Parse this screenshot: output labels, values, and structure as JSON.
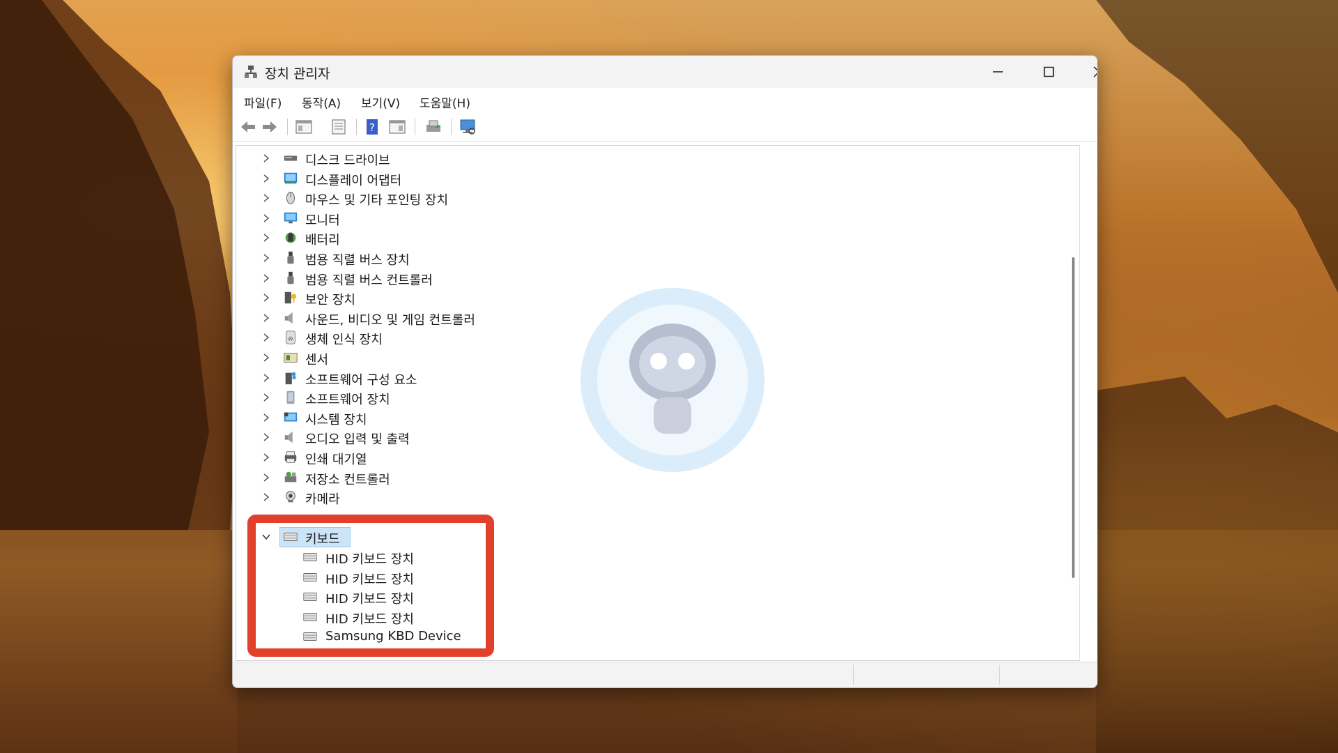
{
  "window": {
    "title": "장치 관리자",
    "icon": "device-manager-icon"
  },
  "menu": [
    "파일(F)",
    "동작(A)",
    "보기(V)",
    "도움말(H)"
  ],
  "toolbar": [
    "back-arrow-icon",
    "forward-arrow-icon",
    "show-hide-tree-icon",
    "properties-icon",
    "help-icon",
    "action-pane-icon",
    "update-driver-icon",
    "scan-hardware-icon"
  ],
  "tree": {
    "collapsed": [
      {
        "label": "디스크 드라이브",
        "icon": "disk-drive-icon"
      },
      {
        "label": "디스플레이 어댑터",
        "icon": "display-adapter-icon"
      },
      {
        "label": "마우스 및 기타 포인팅 장치",
        "icon": "mouse-icon"
      },
      {
        "label": "모니터",
        "icon": "monitor-icon"
      },
      {
        "label": "배터리",
        "icon": "battery-icon"
      },
      {
        "label": "범용 직렬 버스 장치",
        "icon": "usb-device-icon"
      },
      {
        "label": "범용 직렬 버스 컨트롤러",
        "icon": "usb-controller-icon"
      },
      {
        "label": "보안 장치",
        "icon": "security-device-icon"
      },
      {
        "label": "사운드, 비디오 및 게임 컨트롤러",
        "icon": "sound-icon"
      },
      {
        "label": "생체 인식 장치",
        "icon": "biometric-icon"
      },
      {
        "label": "센서",
        "icon": "sensor-icon"
      },
      {
        "label": "소프트웨어 구성 요소",
        "icon": "software-component-icon"
      },
      {
        "label": "소프트웨어 장치",
        "icon": "software-device-icon"
      },
      {
        "label": "시스템 장치",
        "icon": "system-device-icon"
      },
      {
        "label": "오디오 입력 및 출력",
        "icon": "audio-io-icon"
      },
      {
        "label": "인쇄 대기열",
        "icon": "print-queue-icon"
      },
      {
        "label": "저장소 컨트롤러",
        "icon": "storage-controller-icon"
      },
      {
        "label": "카메라",
        "icon": "camera-icon"
      }
    ],
    "expanded": {
      "label": "키보드",
      "icon": "keyboard-icon",
      "children": [
        "HID 키보드 장치",
        "HID 키보드 장치",
        "HID 키보드 장치",
        "HID 키보드 장치",
        "Samsung KBD Device"
      ]
    }
  },
  "colors": {
    "highlight": "#e1412a",
    "selection": "#cce4f7"
  }
}
